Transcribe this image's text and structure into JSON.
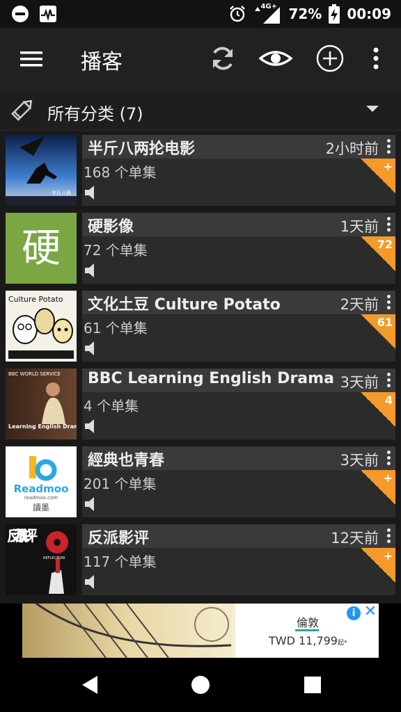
{
  "status_bar": {
    "network": "4G+",
    "battery": "72%",
    "time": "00:09",
    "icons": [
      "do-not-disturb-icon",
      "activity-monitor-icon",
      "alarm-icon",
      "signal-icon",
      "battery-charging-icon"
    ]
  },
  "app_bar": {
    "title": "播客",
    "actions": [
      "menu-icon",
      "refresh-icon",
      "eye-icon",
      "add-circle-icon",
      "more-vert-icon"
    ]
  },
  "category": {
    "label": "所有分类 (7)"
  },
  "podcasts": [
    {
      "title": "半斤八两抡电影",
      "time": "2小时前",
      "episodes": "168 个单集",
      "badge": "+"
    },
    {
      "title": "硬影像",
      "time": "1天前",
      "episodes": "72 个单集",
      "badge": "72"
    },
    {
      "title": "文化土豆 Culture Potato",
      "time": "2天前",
      "episodes": "61 个单集",
      "badge": "61"
    },
    {
      "title": "BBC Learning English Drama",
      "time": "3天前",
      "episodes": "4 个单集",
      "badge": "4"
    },
    {
      "title": "經典也青春",
      "time": "3天前",
      "episodes": "201 个单集",
      "badge": "+"
    },
    {
      "title": "反派影评",
      "time": "12天前",
      "episodes": "117 个单集",
      "badge": "+"
    }
  ],
  "thumb_text": {
    "banjin": "半斤八两",
    "yingyingxiang": "硬",
    "culture_potato": "Culture Potato",
    "bbc_world_service": "BBC WORLD SERVICE",
    "bbc_show": "Learning English Drama",
    "readmoo": "Readmoo",
    "readmoo_url": "readmoo.com",
    "readmoo_cn": "讀墨",
    "fanpai": "反派影评",
    "fanpai_sub": "REFLECTION"
  },
  "ad": {
    "city": "倫敦",
    "price": "TWD 11,799",
    "price_suffix": "起*",
    "info_icon": "i",
    "close_icon": "✕"
  },
  "colors": {
    "accent": "#f39a2a",
    "app_bar": "#212121",
    "status_bar": "#121212",
    "row_info": "#2b2b2b",
    "row_title_strip": "#3a3a3a",
    "yingyingxiang_thumb": "#7aa644"
  }
}
